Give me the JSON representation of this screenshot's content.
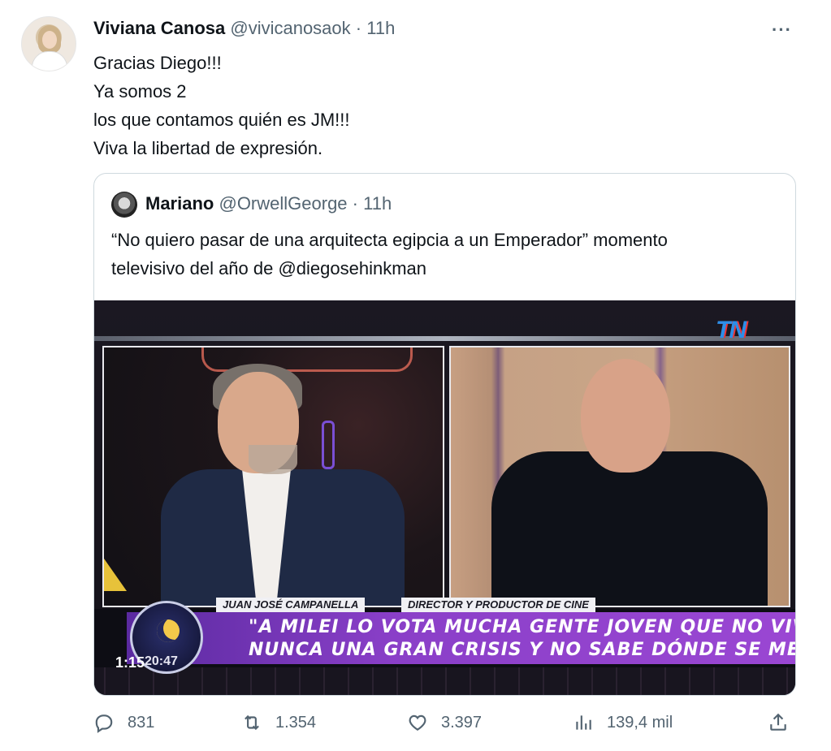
{
  "tweet": {
    "author_name": "Viviana Canosa",
    "author_handle": "@vivicanosaok",
    "separator": "·",
    "time": "11h",
    "more_label": "···",
    "text_lines": [
      "Gracias Diego!!!",
      "Ya somos 2",
      "los que contamos quién es JM!!!",
      "Viva la libertad de expresión."
    ]
  },
  "quoted": {
    "author_name": "Mariano",
    "author_handle": "@OrwellGeorge",
    "separator": "·",
    "time": "11h",
    "text_lines": [
      "“No quiero pasar de una arquitecta egipcia a un Emperador” momento",
      "televisivo del año de @diegosehinkman"
    ],
    "video": {
      "channel_logo": "TN",
      "name_tag": "JUAN JOSÉ CAMPANELLA",
      "role_tag": "DIRECTOR Y PRODUCTOR DE CINE",
      "quote_line_1": "\"A MILEI LO VOTA MUCHA GENTE JOVEN QUE NO VIVIÓ",
      "quote_line_2": "NUNCA UNA GRAN CRISIS Y NO SABE DÓNDE SE METE\"",
      "clock_time": "20:47",
      "duration": "1:15"
    }
  },
  "actions": {
    "replies": "831",
    "retweets": "1.354",
    "likes": "3.397",
    "views": "139,4 mil"
  },
  "icons": {
    "reply": "reply-icon",
    "retweet": "retweet-icon",
    "like": "heart-icon",
    "views": "views-icon",
    "share": "share-icon"
  },
  "colors": {
    "text": "#0f1419",
    "muted": "#536471",
    "border": "#cfd9de",
    "lower_third": "#8a3fc8",
    "tn_blue": "#2c8ee8"
  }
}
